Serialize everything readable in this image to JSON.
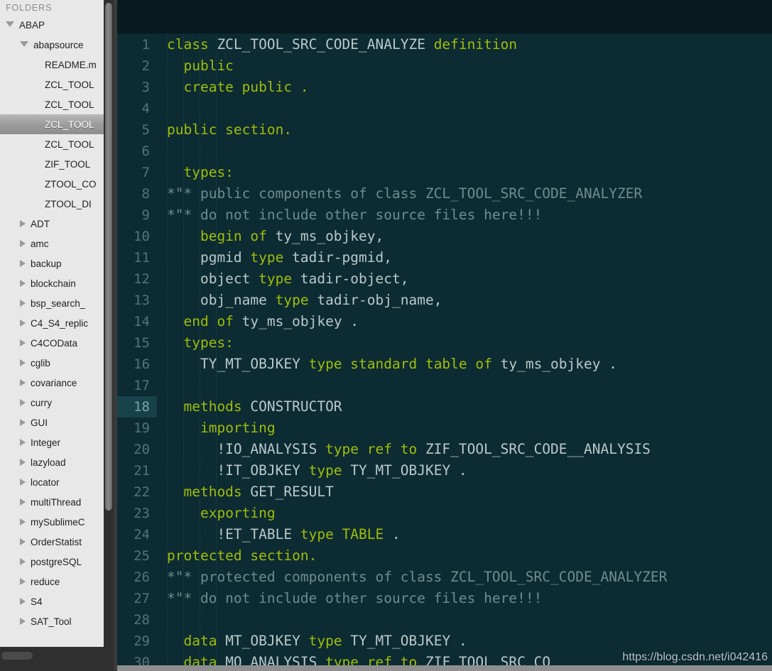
{
  "sidebar": {
    "header": "FOLDERS",
    "items": [
      {
        "label": "ABAP",
        "indent": 0,
        "twisty": "open",
        "selected": false
      },
      {
        "label": "abapsource",
        "indent": 1,
        "twisty": "open",
        "selected": false
      },
      {
        "label": "README.m",
        "indent": 2,
        "twisty": "none",
        "selected": false
      },
      {
        "label": "ZCL_TOOL",
        "indent": 2,
        "twisty": "none",
        "selected": false
      },
      {
        "label": "ZCL_TOOL",
        "indent": 2,
        "twisty": "none",
        "selected": false
      },
      {
        "label": "ZCL_TOOL",
        "indent": 2,
        "twisty": "none",
        "selected": true
      },
      {
        "label": "ZCL_TOOL",
        "indent": 2,
        "twisty": "none",
        "selected": false
      },
      {
        "label": "ZIF_TOOL",
        "indent": 2,
        "twisty": "none",
        "selected": false
      },
      {
        "label": "ZTOOL_CO",
        "indent": 2,
        "twisty": "none",
        "selected": false
      },
      {
        "label": "ZTOOL_DI",
        "indent": 2,
        "twisty": "none",
        "selected": false
      },
      {
        "label": "ADT",
        "indent": 1,
        "twisty": "closed",
        "selected": false
      },
      {
        "label": "amc",
        "indent": 1,
        "twisty": "closed",
        "selected": false
      },
      {
        "label": "backup",
        "indent": 1,
        "twisty": "closed",
        "selected": false
      },
      {
        "label": "blockchain",
        "indent": 1,
        "twisty": "closed",
        "selected": false
      },
      {
        "label": "bsp_search_",
        "indent": 1,
        "twisty": "closed",
        "selected": false
      },
      {
        "label": "C4_S4_replic",
        "indent": 1,
        "twisty": "closed",
        "selected": false
      },
      {
        "label": "C4COData",
        "indent": 1,
        "twisty": "closed",
        "selected": false
      },
      {
        "label": "cglib",
        "indent": 1,
        "twisty": "closed",
        "selected": false
      },
      {
        "label": "covariance",
        "indent": 1,
        "twisty": "closed",
        "selected": false
      },
      {
        "label": "curry",
        "indent": 1,
        "twisty": "closed",
        "selected": false
      },
      {
        "label": "GUI",
        "indent": 1,
        "twisty": "closed",
        "selected": false
      },
      {
        "label": "Integer",
        "indent": 1,
        "twisty": "closed",
        "selected": false
      },
      {
        "label": "lazyload",
        "indent": 1,
        "twisty": "closed",
        "selected": false
      },
      {
        "label": "locator",
        "indent": 1,
        "twisty": "closed",
        "selected": false
      },
      {
        "label": "multiThread",
        "indent": 1,
        "twisty": "closed",
        "selected": false
      },
      {
        "label": "mySublimeC",
        "indent": 1,
        "twisty": "closed",
        "selected": false
      },
      {
        "label": "OrderStatist",
        "indent": 1,
        "twisty": "closed",
        "selected": false
      },
      {
        "label": "postgreSQL",
        "indent": 1,
        "twisty": "closed",
        "selected": false
      },
      {
        "label": "reduce",
        "indent": 1,
        "twisty": "closed",
        "selected": false
      },
      {
        "label": "S4",
        "indent": 1,
        "twisty": "closed",
        "selected": false
      },
      {
        "label": "SAT_Tool",
        "indent": 1,
        "twisty": "closed",
        "selected": false
      }
    ]
  },
  "editor": {
    "active_line": 18,
    "colors": {
      "background": "#0d2b32",
      "tabbar": "#061a1f",
      "keyword": "#9fbe0a",
      "identifier": "#b9c9cc",
      "comment": "#6f8c90",
      "gutter_text": "#53737a",
      "active_line_gutter": "#17424b",
      "sidebar_background": "#e8e8e8"
    },
    "lines": [
      {
        "n": 1,
        "tokens": [
          {
            "t": "class",
            "c": "kw"
          },
          {
            "t": " ZCL_TOOL_SRC_CODE_ANALYZE ",
            "c": "id"
          },
          {
            "t": "definition",
            "c": "kw"
          }
        ]
      },
      {
        "n": 2,
        "tokens": [
          {
            "t": "  ",
            "c": "id"
          },
          {
            "t": "public",
            "c": "kw"
          }
        ]
      },
      {
        "n": 3,
        "tokens": [
          {
            "t": "  ",
            "c": "id"
          },
          {
            "t": "create public .",
            "c": "kw"
          }
        ]
      },
      {
        "n": 4,
        "tokens": []
      },
      {
        "n": 5,
        "tokens": [
          {
            "t": "public section.",
            "c": "kw"
          }
        ]
      },
      {
        "n": 6,
        "tokens": []
      },
      {
        "n": 7,
        "tokens": [
          {
            "t": "  ",
            "c": "id"
          },
          {
            "t": "types:",
            "c": "kw"
          }
        ]
      },
      {
        "n": 8,
        "tokens": [
          {
            "t": "*\"* public components of class ZCL_TOOL_SRC_CODE_ANALYZER",
            "c": "cm"
          }
        ]
      },
      {
        "n": 9,
        "tokens": [
          {
            "t": "*\"* do not include other source files here!!!",
            "c": "cm"
          }
        ]
      },
      {
        "n": 10,
        "tokens": [
          {
            "t": "    ",
            "c": "id"
          },
          {
            "t": "begin of",
            "c": "kw"
          },
          {
            "t": " ty_ms_objkey,",
            "c": "id"
          }
        ]
      },
      {
        "n": 11,
        "tokens": [
          {
            "t": "    pgmid ",
            "c": "id"
          },
          {
            "t": "type",
            "c": "kw"
          },
          {
            "t": " tadir-pgmid,",
            "c": "id"
          }
        ]
      },
      {
        "n": 12,
        "tokens": [
          {
            "t": "    object ",
            "c": "id"
          },
          {
            "t": "type",
            "c": "kw"
          },
          {
            "t": " tadir-object,",
            "c": "id"
          }
        ]
      },
      {
        "n": 13,
        "tokens": [
          {
            "t": "    obj_name ",
            "c": "id"
          },
          {
            "t": "type",
            "c": "kw"
          },
          {
            "t": " tadir-obj_name,",
            "c": "id"
          }
        ]
      },
      {
        "n": 14,
        "tokens": [
          {
            "t": "  ",
            "c": "id"
          },
          {
            "t": "end of",
            "c": "kw"
          },
          {
            "t": " ty_ms_objkey .",
            "c": "id"
          }
        ]
      },
      {
        "n": 15,
        "tokens": [
          {
            "t": "  ",
            "c": "id"
          },
          {
            "t": "types:",
            "c": "kw"
          }
        ]
      },
      {
        "n": 16,
        "tokens": [
          {
            "t": "    TY_MT_OBJKEY ",
            "c": "id"
          },
          {
            "t": "type standard table of",
            "c": "kw"
          },
          {
            "t": " ty_ms_objkey .",
            "c": "id"
          }
        ]
      },
      {
        "n": 17,
        "tokens": []
      },
      {
        "n": 18,
        "tokens": [
          {
            "t": "  ",
            "c": "id"
          },
          {
            "t": "methods",
            "c": "kw"
          },
          {
            "t": " CONSTRUCTOR",
            "c": "id"
          }
        ]
      },
      {
        "n": 19,
        "tokens": [
          {
            "t": "    ",
            "c": "id"
          },
          {
            "t": "importing",
            "c": "kw"
          }
        ]
      },
      {
        "n": 20,
        "tokens": [
          {
            "t": "      !IO_ANALYSIS ",
            "c": "id"
          },
          {
            "t": "type ref to",
            "c": "kw"
          },
          {
            "t": " ZIF_TOOL_SRC_CODE__ANALYSIS",
            "c": "id"
          }
        ]
      },
      {
        "n": 21,
        "tokens": [
          {
            "t": "      !IT_OBJKEY ",
            "c": "id"
          },
          {
            "t": "type",
            "c": "kw"
          },
          {
            "t": " TY_MT_OBJKEY .",
            "c": "id"
          }
        ]
      },
      {
        "n": 22,
        "tokens": [
          {
            "t": "  ",
            "c": "id"
          },
          {
            "t": "methods",
            "c": "kw"
          },
          {
            "t": " GET_RESULT",
            "c": "id"
          }
        ]
      },
      {
        "n": 23,
        "tokens": [
          {
            "t": "    ",
            "c": "id"
          },
          {
            "t": "exporting",
            "c": "kw"
          }
        ]
      },
      {
        "n": 24,
        "tokens": [
          {
            "t": "      !ET_TABLE ",
            "c": "id"
          },
          {
            "t": "type TABLE",
            "c": "kw"
          },
          {
            "t": " .",
            "c": "id"
          }
        ]
      },
      {
        "n": 25,
        "tokens": [
          {
            "t": "protected section.",
            "c": "kw"
          }
        ]
      },
      {
        "n": 26,
        "tokens": [
          {
            "t": "*\"* protected components of class ZCL_TOOL_SRC_CODE_ANALYZER",
            "c": "cm"
          }
        ]
      },
      {
        "n": 27,
        "tokens": [
          {
            "t": "*\"* do not include other source files here!!!",
            "c": "cm"
          }
        ]
      },
      {
        "n": 28,
        "tokens": []
      },
      {
        "n": 29,
        "tokens": [
          {
            "t": "  ",
            "c": "id"
          },
          {
            "t": "data",
            "c": "kw"
          },
          {
            "t": " MT_OBJKEY ",
            "c": "id"
          },
          {
            "t": "type",
            "c": "kw"
          },
          {
            "t": " TY_MT_OBJKEY .",
            "c": "id"
          }
        ]
      },
      {
        "n": 30,
        "tokens": [
          {
            "t": "  ",
            "c": "id"
          },
          {
            "t": "data",
            "c": "kw"
          },
          {
            "t": " MO_ANALYSIS ",
            "c": "id"
          },
          {
            "t": "type ref to",
            "c": "kw"
          },
          {
            "t": " ZIF_TOOL_SRC_CO",
            "c": "id"
          }
        ]
      }
    ]
  },
  "watermark": "https://blog.csdn.net/i042416"
}
